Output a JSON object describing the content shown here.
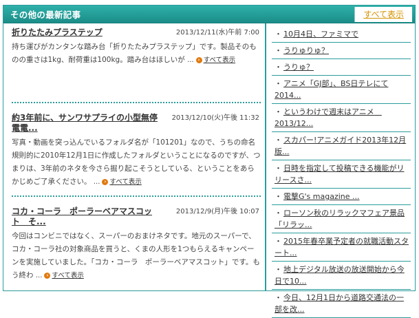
{
  "header": {
    "title": "その他の最新記事",
    "show_all": "すべて表示"
  },
  "articles": [
    {
      "title": "折りたたみプラステップ",
      "date": "2013/12/11(水)午前 7:00",
      "body": "持ち運びがカンタンな踏み台「折りたたみプラステップ」です。製品そのものの重さは1kg、耐荷重は100kg。踏み台はほしいが",
      "more": "すべて表示"
    },
    {
      "title": "約3年前に、サンワサプライの小型無停電電...",
      "date": "2013/12/10(火)午後 11:32",
      "body": "写真・動画を突っ込んでいるフォルダ名が「101201」なので、うちの命名規則的に2010年12月1日に作成したフォルダということになるのですが、つまりは、3年前のネタを今さら掘り起こそうとしている、ということをあらかじめご了承ください。",
      "more": "すべて表示"
    },
    {
      "title": "コカ・コーラ　ポーラーベアマスコット　そ...",
      "date": "2013/12/9(月)午後 10:07",
      "body": "今回はコンビニではなく、スーパーのおまけネタです。地元のスーパーで、コカ・コーラ社の対象商品を買うと、くまの人形を1つもらえるキャンペーンを実施していました。「コカ・コーラ　ポーラーベアマスコット」です。もう終わ",
      "more": "すべて表示"
    }
  ],
  "ellipsis": "...",
  "sidebar": {
    "bullet": "・",
    "items": [
      "10月4日、ファミマで",
      "うりゅりゅ？",
      "うりゅ？",
      "アニメ「GJ部」、BS日テレにて2014...",
      "というわけで週末はアニメ　2013/12...",
      "スカパー!アニメガイド2013年12月版...",
      "日時を指定して投稿できる機能がリリースさ...",
      "電撃G's magazine ...",
      "ローソン秋のリラックマフェア景品「リラッ...",
      "2015年春卒業予定者の就職活動スタート...",
      "地上デジタル放送の放送開始から今日で10...",
      "今日、12月1日から道路交通法の一部を改..."
    ]
  }
}
